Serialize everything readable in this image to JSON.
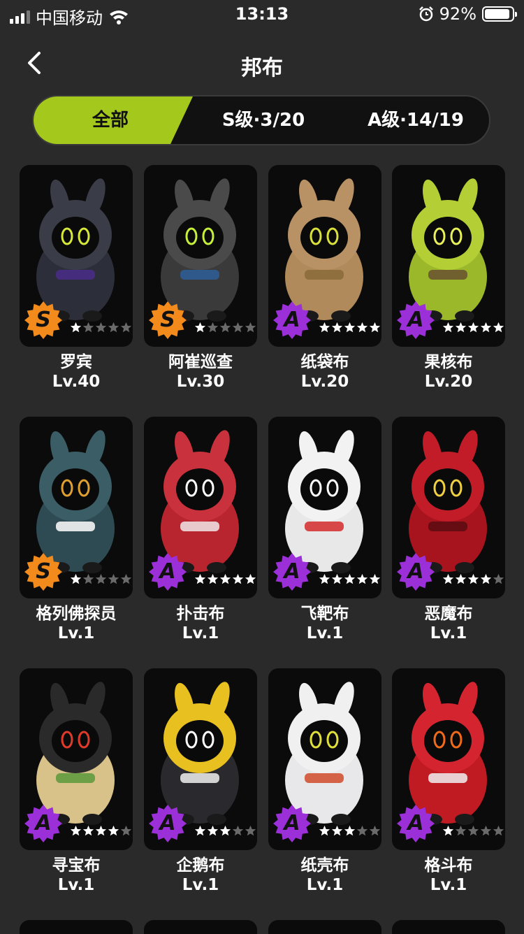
{
  "status_bar": {
    "carrier": "中国移动",
    "time": "13:13",
    "battery": "92%",
    "battery_level": 0.92
  },
  "header": {
    "title": "邦布",
    "back_icon": "chevron-left-icon"
  },
  "tabs": [
    {
      "label": "全部",
      "active": true
    },
    {
      "label": "S级·3/20",
      "active": false
    },
    {
      "label": "A级·14/19",
      "active": false
    }
  ],
  "colors": {
    "accent": "#a4c91c",
    "rank_s": "#f28a1c",
    "rank_a": "#9b2fd8",
    "background": "#2a2a2a",
    "card": "#0b0b0b"
  },
  "bangboos": [
    {
      "name": "罗宾",
      "level": "Lv.40",
      "rank": "S",
      "stars": 1,
      "body": "#2c2f3a",
      "hood": "#3a3d48",
      "eye": "#d6e83a",
      "accent": "#4a2c8a"
    },
    {
      "name": "阿崔巡查",
      "level": "Lv.30",
      "rank": "S",
      "stars": 1,
      "body": "#3a3a3a",
      "hood": "#4a4a4a",
      "eye": "#c6f03a",
      "accent": "#2f5f9a"
    },
    {
      "name": "纸袋布",
      "level": "Lv.20",
      "rank": "A",
      "stars": 5,
      "body": "#b08a5a",
      "hood": "#b89264",
      "eye": "#d9e03a",
      "accent": "#8a6a3a"
    },
    {
      "name": "果核布",
      "level": "Lv.20",
      "rank": "A",
      "stars": 5,
      "body": "#9bb82a",
      "hood": "#b4cf36",
      "eye": "#e8f05a",
      "accent": "#6a5030"
    },
    {
      "name": "格列佛探员",
      "level": "Lv.1",
      "rank": "S",
      "stars": 1,
      "body": "#2e4a52",
      "hood": "#3b5d66",
      "eye": "#e0a030",
      "accent": "#ffffff"
    },
    {
      "name": "扑击布",
      "level": "Lv.1",
      "rank": "A",
      "stars": 5,
      "body": "#b8252f",
      "hood": "#c9323c",
      "eye": "#ffffff",
      "accent": "#f0e8e8"
    },
    {
      "name": "飞靶布",
      "level": "Lv.1",
      "rank": "A",
      "stars": 5,
      "body": "#e8e8e8",
      "hood": "#f2f2f2",
      "eye": "#ffffff",
      "accent": "#d42a2a"
    },
    {
      "name": "恶魔布",
      "level": "Lv.1",
      "rank": "A",
      "stars": 4,
      "body": "#a8141e",
      "hood": "#c21c28",
      "eye": "#f0d040",
      "accent": "#5a0a12"
    },
    {
      "name": "寻宝布",
      "level": "Lv.1",
      "rank": "A",
      "stars": 4,
      "body": "#d8c28a",
      "hood": "#2a2a2a",
      "eye": "#e03a2a",
      "accent": "#5a9a3a"
    },
    {
      "name": "企鹅布",
      "level": "Lv.1",
      "rank": "A",
      "stars": 3,
      "body": "#2a2a2e",
      "hood": "#e8c020",
      "eye": "#ffffff",
      "accent": "#f0f0f0"
    },
    {
      "name": "纸壳布",
      "level": "Lv.1",
      "rank": "A",
      "stars": 3,
      "body": "#e8e8ea",
      "hood": "#f0f0f0",
      "eye": "#e0e03a",
      "accent": "#d04a2a"
    },
    {
      "name": "格斗布",
      "level": "Lv.1",
      "rank": "A",
      "stars": 1,
      "body": "#c01a22",
      "hood": "#d42430",
      "eye": "#f06a1a",
      "accent": "#f0f0f0"
    }
  ]
}
